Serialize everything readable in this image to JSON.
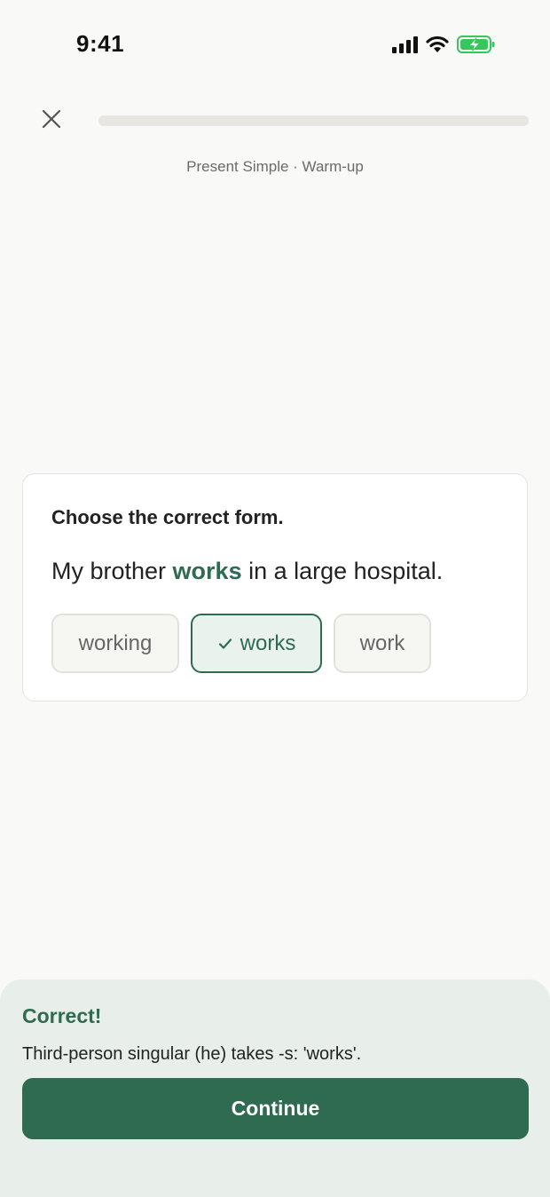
{
  "status_bar": {
    "time": "9:41",
    "icons": [
      "signal-icon",
      "wifi-icon",
      "battery-charging-icon"
    ],
    "battery_color": "#34c759"
  },
  "top_bar": {
    "close_icon": "close-icon",
    "progress": 0,
    "lesson_title": "Present Simple · Warm-up"
  },
  "question": {
    "instruction": "Choose the correct form.",
    "sentence_before": "My brother ",
    "sentence_answer": "works",
    "sentence_after": " in a large hospital.",
    "options": [
      {
        "label": "working",
        "state": "default"
      },
      {
        "label": "works",
        "state": "selected-correct"
      },
      {
        "label": "work",
        "state": "default"
      }
    ]
  },
  "feedback": {
    "title": "Correct!",
    "explanation": "Third-person singular (he) takes -s: 'works'.",
    "continue_label": "Continue"
  },
  "colors": {
    "accent": "#2e6b50",
    "background": "#f9f9f7",
    "sheet_background": "#e8efea"
  }
}
